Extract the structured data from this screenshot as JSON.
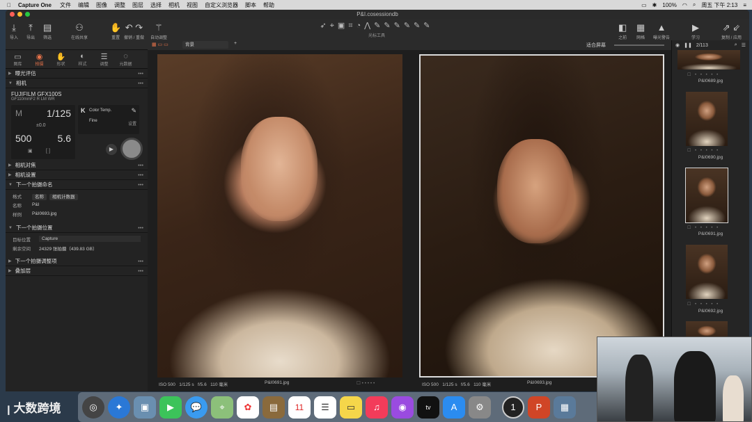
{
  "menubar": {
    "app": "Capture One",
    "items": [
      "文件",
      "编辑",
      "图像",
      "调整",
      "图层",
      "选择",
      "相机",
      "视图",
      "自定义浏览器",
      "脚本",
      "帮助"
    ],
    "battery": "100%",
    "clock": "周五 下午 2:13"
  },
  "window": {
    "title": "P&I.cosessiondb"
  },
  "toolbar": {
    "import": "导入",
    "export": "导出",
    "filter": "筛选",
    "shared": "在线共享",
    "reset": "重置",
    "undo_redo": "撤销 / 重做",
    "auto": "自动调整",
    "cursor_tools": "光标工具",
    "before": "之前",
    "grid": "网格",
    "exposure_warn": "曝光警告",
    "learn": "学习",
    "copy_apply": "复制 / 应用"
  },
  "tool_tabs": [
    "图库",
    "拍摄",
    "形状",
    "样式",
    "调整",
    "元数据"
  ],
  "left_panel": {
    "histogram": "曝光评估",
    "camera_section": "相机",
    "camera_model": "FUJIFILM GFX100S",
    "lens": "GF110mmF2 R LM WR",
    "mode": "M",
    "shutter": "1/125",
    "ev": "±0.0",
    "iso": "500",
    "aperture": "5.6",
    "wb_label": "K",
    "wb_mode": "Color Temp.",
    "quality": "Fine",
    "settings": "设置",
    "focus": "相机对焦",
    "cam_settings": "相机设置",
    "next_name": "下一个拍摄命名",
    "fmt_label": "格式",
    "fmt_tokens": [
      "名称",
      "相机计数器"
    ],
    "name_label": "名称",
    "name_value": "P&I",
    "sample_label": "样例",
    "sample_value": "P&I0693.jpg",
    "next_loc": "下一个拍摄位置",
    "target_label": "目标位置",
    "target_value": "Capture",
    "space_label": "剩余空间",
    "space_value": "24329 张拍摄（439.83 GB）",
    "next_adj": "下一个拍摄调整项",
    "overlay": "叠加层"
  },
  "viewer": {
    "background": "背景",
    "fit": "适合屏幕",
    "count": "2/113",
    "left_caption": {
      "iso": "ISO 500",
      "shutter": "1/125 s",
      "aperture": "f/5.6",
      "focal": "110 毫米",
      "file": "P&I0691.jpg"
    },
    "right_caption": {
      "iso": "ISO 500",
      "shutter": "1/125 s",
      "aperture": "f/5.6",
      "focal": "110 毫米",
      "file": "P&I0693.jpg"
    }
  },
  "filmstrip": [
    "P&I0689.jpg",
    "P&I0690.jpg",
    "P&I0691.jpg",
    "P&I0692.jpg"
  ],
  "brand": "大数跨境"
}
